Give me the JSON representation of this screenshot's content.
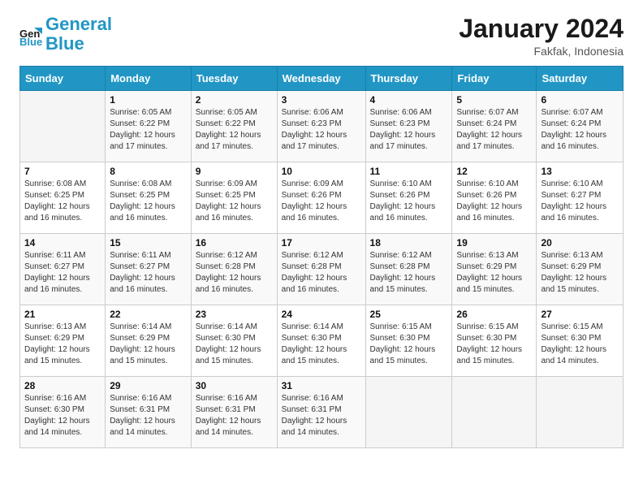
{
  "header": {
    "logo_line1": "General",
    "logo_line2": "Blue",
    "title": "January 2024",
    "subtitle": "Fakfak, Indonesia"
  },
  "columns": [
    "Sunday",
    "Monday",
    "Tuesday",
    "Wednesday",
    "Thursday",
    "Friday",
    "Saturday"
  ],
  "weeks": [
    [
      {
        "day": "",
        "sunrise": "",
        "sunset": "",
        "daylight": ""
      },
      {
        "day": "1",
        "sunrise": "6:05 AM",
        "sunset": "6:22 PM",
        "daylight": "12 hours and 17 minutes."
      },
      {
        "day": "2",
        "sunrise": "6:05 AM",
        "sunset": "6:22 PM",
        "daylight": "12 hours and 17 minutes."
      },
      {
        "day": "3",
        "sunrise": "6:06 AM",
        "sunset": "6:23 PM",
        "daylight": "12 hours and 17 minutes."
      },
      {
        "day": "4",
        "sunrise": "6:06 AM",
        "sunset": "6:23 PM",
        "daylight": "12 hours and 17 minutes."
      },
      {
        "day": "5",
        "sunrise": "6:07 AM",
        "sunset": "6:24 PM",
        "daylight": "12 hours and 17 minutes."
      },
      {
        "day": "6",
        "sunrise": "6:07 AM",
        "sunset": "6:24 PM",
        "daylight": "12 hours and 16 minutes."
      }
    ],
    [
      {
        "day": "7",
        "sunrise": "6:08 AM",
        "sunset": "6:25 PM",
        "daylight": "12 hours and 16 minutes."
      },
      {
        "day": "8",
        "sunrise": "6:08 AM",
        "sunset": "6:25 PM",
        "daylight": "12 hours and 16 minutes."
      },
      {
        "day": "9",
        "sunrise": "6:09 AM",
        "sunset": "6:25 PM",
        "daylight": "12 hours and 16 minutes."
      },
      {
        "day": "10",
        "sunrise": "6:09 AM",
        "sunset": "6:26 PM",
        "daylight": "12 hours and 16 minutes."
      },
      {
        "day": "11",
        "sunrise": "6:10 AM",
        "sunset": "6:26 PM",
        "daylight": "12 hours and 16 minutes."
      },
      {
        "day": "12",
        "sunrise": "6:10 AM",
        "sunset": "6:26 PM",
        "daylight": "12 hours and 16 minutes."
      },
      {
        "day": "13",
        "sunrise": "6:10 AM",
        "sunset": "6:27 PM",
        "daylight": "12 hours and 16 minutes."
      }
    ],
    [
      {
        "day": "14",
        "sunrise": "6:11 AM",
        "sunset": "6:27 PM",
        "daylight": "12 hours and 16 minutes."
      },
      {
        "day": "15",
        "sunrise": "6:11 AM",
        "sunset": "6:27 PM",
        "daylight": "12 hours and 16 minutes."
      },
      {
        "day": "16",
        "sunrise": "6:12 AM",
        "sunset": "6:28 PM",
        "daylight": "12 hours and 16 minutes."
      },
      {
        "day": "17",
        "sunrise": "6:12 AM",
        "sunset": "6:28 PM",
        "daylight": "12 hours and 16 minutes."
      },
      {
        "day": "18",
        "sunrise": "6:12 AM",
        "sunset": "6:28 PM",
        "daylight": "12 hours and 15 minutes."
      },
      {
        "day": "19",
        "sunrise": "6:13 AM",
        "sunset": "6:29 PM",
        "daylight": "12 hours and 15 minutes."
      },
      {
        "day": "20",
        "sunrise": "6:13 AM",
        "sunset": "6:29 PM",
        "daylight": "12 hours and 15 minutes."
      }
    ],
    [
      {
        "day": "21",
        "sunrise": "6:13 AM",
        "sunset": "6:29 PM",
        "daylight": "12 hours and 15 minutes."
      },
      {
        "day": "22",
        "sunrise": "6:14 AM",
        "sunset": "6:29 PM",
        "daylight": "12 hours and 15 minutes."
      },
      {
        "day": "23",
        "sunrise": "6:14 AM",
        "sunset": "6:30 PM",
        "daylight": "12 hours and 15 minutes."
      },
      {
        "day": "24",
        "sunrise": "6:14 AM",
        "sunset": "6:30 PM",
        "daylight": "12 hours and 15 minutes."
      },
      {
        "day": "25",
        "sunrise": "6:15 AM",
        "sunset": "6:30 PM",
        "daylight": "12 hours and 15 minutes."
      },
      {
        "day": "26",
        "sunrise": "6:15 AM",
        "sunset": "6:30 PM",
        "daylight": "12 hours and 15 minutes."
      },
      {
        "day": "27",
        "sunrise": "6:15 AM",
        "sunset": "6:30 PM",
        "daylight": "12 hours and 14 minutes."
      }
    ],
    [
      {
        "day": "28",
        "sunrise": "6:16 AM",
        "sunset": "6:30 PM",
        "daylight": "12 hours and 14 minutes."
      },
      {
        "day": "29",
        "sunrise": "6:16 AM",
        "sunset": "6:31 PM",
        "daylight": "12 hours and 14 minutes."
      },
      {
        "day": "30",
        "sunrise": "6:16 AM",
        "sunset": "6:31 PM",
        "daylight": "12 hours and 14 minutes."
      },
      {
        "day": "31",
        "sunrise": "6:16 AM",
        "sunset": "6:31 PM",
        "daylight": "12 hours and 14 minutes."
      },
      {
        "day": "",
        "sunrise": "",
        "sunset": "",
        "daylight": ""
      },
      {
        "day": "",
        "sunrise": "",
        "sunset": "",
        "daylight": ""
      },
      {
        "day": "",
        "sunrise": "",
        "sunset": "",
        "daylight": ""
      }
    ]
  ],
  "labels": {
    "sunrise_prefix": "Sunrise: ",
    "sunset_prefix": "Sunset: ",
    "daylight_prefix": "Daylight: "
  }
}
